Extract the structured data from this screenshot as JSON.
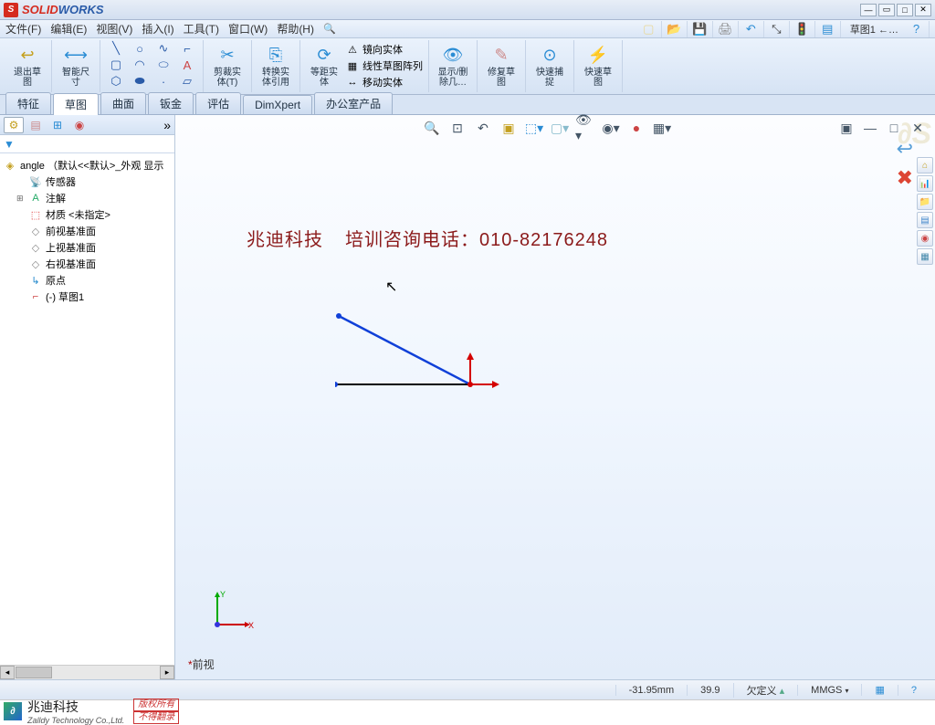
{
  "app": {
    "name_solid": "SOLID",
    "name_works": "WORKS"
  },
  "menus": [
    "文件(F)",
    "编辑(E)",
    "视图(V)",
    "插入(I)",
    "工具(T)",
    "窗口(W)",
    "帮助(H)"
  ],
  "breadcrumb": "草图1 ←…",
  "ribbon": {
    "exit_sketch": "退出草\n图",
    "smart_dim": "智能尺\n寸",
    "trim": "剪裁实\n体(T)",
    "convert": "转换实\n体引用",
    "offset": "等距实\n体",
    "mirror": "镜向实体",
    "pattern": "线性草图阵列",
    "move": "移动实体",
    "show_hide": "显示/删\n除几…",
    "repair": "修复草\n图",
    "snap": "快速捕\n捉",
    "rapid": "快速草\n图"
  },
  "tabs": [
    "特征",
    "草图",
    "曲面",
    "钣金",
    "评估",
    "DimXpert",
    "办公室产品"
  ],
  "active_tab": 1,
  "tree": {
    "root": "angle （默认<<默认>_外观 显示",
    "items": [
      {
        "icon": "📡",
        "label": "传感器",
        "color": "#c90"
      },
      {
        "icon": "A",
        "label": "注解",
        "color": "#2a6",
        "expandable": true
      },
      {
        "icon": "⬚",
        "label": "材质 <未指定>",
        "color": "#d33"
      },
      {
        "icon": "◇",
        "label": "前视基准面",
        "color": "#888"
      },
      {
        "icon": "◇",
        "label": "上视基准面",
        "color": "#888"
      },
      {
        "icon": "◇",
        "label": "右视基准面",
        "color": "#888"
      },
      {
        "icon": "↳",
        "label": "原点",
        "color": "#28c"
      },
      {
        "icon": "⌐",
        "label": "(-) 草图1",
        "color": "#c44"
      }
    ]
  },
  "watermark": {
    "company": "兆迪科技",
    "phone_label": "培训咨询电话：",
    "phone": "010-82176248"
  },
  "view_label": "前视",
  "status": {
    "x": "-31.95mm",
    "y": "39.9",
    "defined": "欠定义",
    "units": "MMGS"
  },
  "footer": {
    "cn": "兆迪科技",
    "en": "Zalldy Technology Co.,Ltd.",
    "red1": "版权所有",
    "red2": "不得翻录"
  },
  "triad": {
    "x": "X",
    "y": "Y"
  }
}
